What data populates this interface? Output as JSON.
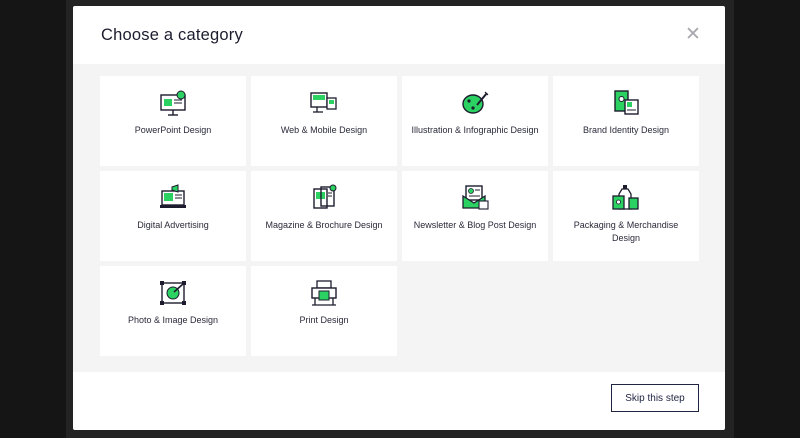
{
  "modal": {
    "title": "Choose a category",
    "close_icon": "close-icon"
  },
  "colors": {
    "accent": "#2bd262",
    "ink": "#1c1c2e",
    "panel": "#f4f4f4"
  },
  "categories": [
    {
      "label": "PowerPoint Design",
      "icon": "presentation-icon"
    },
    {
      "label": "Web & Mobile Design",
      "icon": "devices-icon"
    },
    {
      "label": "Illustration & Infographic Design",
      "icon": "illustration-icon"
    },
    {
      "label": "Brand Identity Design",
      "icon": "brand-identity-icon"
    },
    {
      "label": "Digital Advertising",
      "icon": "digital-ad-icon"
    },
    {
      "label": "Magazine & Brochure Design",
      "icon": "magazine-icon"
    },
    {
      "label": "Newsletter & Blog Post Design",
      "icon": "newsletter-icon"
    },
    {
      "label": "Packaging & Merchandise Design",
      "icon": "packaging-icon"
    },
    {
      "label": "Photo & Image Design",
      "icon": "photo-icon"
    },
    {
      "label": "Print Design",
      "icon": "printer-icon"
    }
  ],
  "footer": {
    "skip_label": "Skip this step"
  }
}
